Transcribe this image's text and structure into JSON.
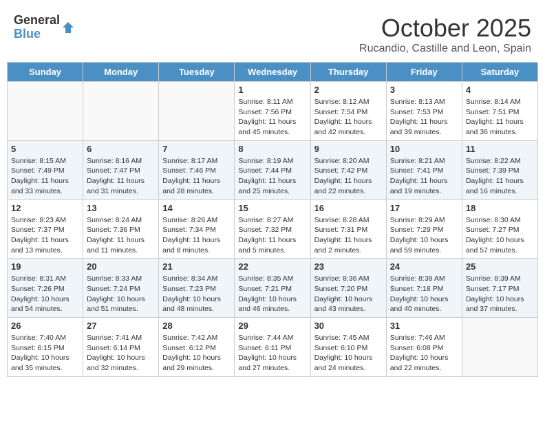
{
  "logo": {
    "general": "General",
    "blue": "Blue"
  },
  "header": {
    "month": "October 2025",
    "location": "Rucandio, Castille and Leon, Spain"
  },
  "weekdays": [
    "Sunday",
    "Monday",
    "Tuesday",
    "Wednesday",
    "Thursday",
    "Friday",
    "Saturday"
  ],
  "weeks": [
    [
      {
        "day": "",
        "info": ""
      },
      {
        "day": "",
        "info": ""
      },
      {
        "day": "",
        "info": ""
      },
      {
        "day": "1",
        "info": "Sunrise: 8:11 AM\nSunset: 7:56 PM\nDaylight: 11 hours and 45 minutes."
      },
      {
        "day": "2",
        "info": "Sunrise: 8:12 AM\nSunset: 7:54 PM\nDaylight: 11 hours and 42 minutes."
      },
      {
        "day": "3",
        "info": "Sunrise: 8:13 AM\nSunset: 7:53 PM\nDaylight: 11 hours and 39 minutes."
      },
      {
        "day": "4",
        "info": "Sunrise: 8:14 AM\nSunset: 7:51 PM\nDaylight: 11 hours and 36 minutes."
      }
    ],
    [
      {
        "day": "5",
        "info": "Sunrise: 8:15 AM\nSunset: 7:49 PM\nDaylight: 11 hours and 33 minutes."
      },
      {
        "day": "6",
        "info": "Sunrise: 8:16 AM\nSunset: 7:47 PM\nDaylight: 11 hours and 31 minutes."
      },
      {
        "day": "7",
        "info": "Sunrise: 8:17 AM\nSunset: 7:46 PM\nDaylight: 11 hours and 28 minutes."
      },
      {
        "day": "8",
        "info": "Sunrise: 8:19 AM\nSunset: 7:44 PM\nDaylight: 11 hours and 25 minutes."
      },
      {
        "day": "9",
        "info": "Sunrise: 8:20 AM\nSunset: 7:42 PM\nDaylight: 11 hours and 22 minutes."
      },
      {
        "day": "10",
        "info": "Sunrise: 8:21 AM\nSunset: 7:41 PM\nDaylight: 11 hours and 19 minutes."
      },
      {
        "day": "11",
        "info": "Sunrise: 8:22 AM\nSunset: 7:39 PM\nDaylight: 11 hours and 16 minutes."
      }
    ],
    [
      {
        "day": "12",
        "info": "Sunrise: 8:23 AM\nSunset: 7:37 PM\nDaylight: 11 hours and 13 minutes."
      },
      {
        "day": "13",
        "info": "Sunrise: 8:24 AM\nSunset: 7:36 PM\nDaylight: 11 hours and 11 minutes."
      },
      {
        "day": "14",
        "info": "Sunrise: 8:26 AM\nSunset: 7:34 PM\nDaylight: 11 hours and 8 minutes."
      },
      {
        "day": "15",
        "info": "Sunrise: 8:27 AM\nSunset: 7:32 PM\nDaylight: 11 hours and 5 minutes."
      },
      {
        "day": "16",
        "info": "Sunrise: 8:28 AM\nSunset: 7:31 PM\nDaylight: 11 hours and 2 minutes."
      },
      {
        "day": "17",
        "info": "Sunrise: 8:29 AM\nSunset: 7:29 PM\nDaylight: 10 hours and 59 minutes."
      },
      {
        "day": "18",
        "info": "Sunrise: 8:30 AM\nSunset: 7:27 PM\nDaylight: 10 hours and 57 minutes."
      }
    ],
    [
      {
        "day": "19",
        "info": "Sunrise: 8:31 AM\nSunset: 7:26 PM\nDaylight: 10 hours and 54 minutes."
      },
      {
        "day": "20",
        "info": "Sunrise: 8:33 AM\nSunset: 7:24 PM\nDaylight: 10 hours and 51 minutes."
      },
      {
        "day": "21",
        "info": "Sunrise: 8:34 AM\nSunset: 7:23 PM\nDaylight: 10 hours and 48 minutes."
      },
      {
        "day": "22",
        "info": "Sunrise: 8:35 AM\nSunset: 7:21 PM\nDaylight: 10 hours and 46 minutes."
      },
      {
        "day": "23",
        "info": "Sunrise: 8:36 AM\nSunset: 7:20 PM\nDaylight: 10 hours and 43 minutes."
      },
      {
        "day": "24",
        "info": "Sunrise: 8:38 AM\nSunset: 7:18 PM\nDaylight: 10 hours and 40 minutes."
      },
      {
        "day": "25",
        "info": "Sunrise: 8:39 AM\nSunset: 7:17 PM\nDaylight: 10 hours and 37 minutes."
      }
    ],
    [
      {
        "day": "26",
        "info": "Sunrise: 7:40 AM\nSunset: 6:15 PM\nDaylight: 10 hours and 35 minutes."
      },
      {
        "day": "27",
        "info": "Sunrise: 7:41 AM\nSunset: 6:14 PM\nDaylight: 10 hours and 32 minutes."
      },
      {
        "day": "28",
        "info": "Sunrise: 7:42 AM\nSunset: 6:12 PM\nDaylight: 10 hours and 29 minutes."
      },
      {
        "day": "29",
        "info": "Sunrise: 7:44 AM\nSunset: 6:11 PM\nDaylight: 10 hours and 27 minutes."
      },
      {
        "day": "30",
        "info": "Sunrise: 7:45 AM\nSunset: 6:10 PM\nDaylight: 10 hours and 24 minutes."
      },
      {
        "day": "31",
        "info": "Sunrise: 7:46 AM\nSunset: 6:08 PM\nDaylight: 10 hours and 22 minutes."
      },
      {
        "day": "",
        "info": ""
      }
    ]
  ]
}
